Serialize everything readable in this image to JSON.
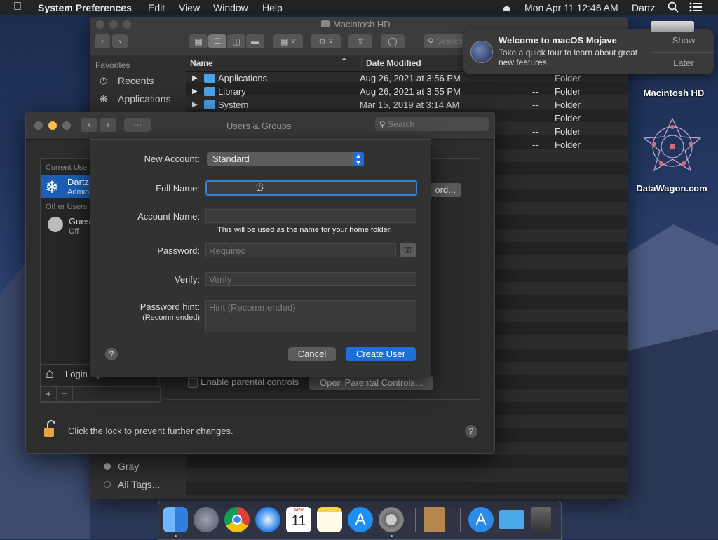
{
  "menubar": {
    "app_name": "System Preferences",
    "menus": [
      "Edit",
      "View",
      "Window",
      "Help"
    ],
    "clock": "Mon Apr 11  12:46 AM",
    "user": "Dartz"
  },
  "finder": {
    "title": "Macintosh HD",
    "search_placeholder": "Search",
    "sidebar_heading": "Favorites",
    "sidebar_items": [
      "Recents",
      "Applications"
    ],
    "tags": [
      "Gray",
      "All Tags..."
    ],
    "columns": {
      "name": "Name",
      "date": "Date Modified"
    },
    "rows": [
      {
        "name": "Applications",
        "date": "Aug 26, 2021 at 3:56 PM",
        "size": "--",
        "kind": "Folder"
      },
      {
        "name": "Library",
        "date": "Aug 26, 2021 at 3:55 PM",
        "size": "--",
        "kind": "Folder"
      },
      {
        "name": "System",
        "date": "Mar 15, 2019 at 3:14 AM",
        "size": "--",
        "kind": "Folder"
      },
      {
        "name": "",
        "date": "",
        "size": "--",
        "kind": "Folder"
      },
      {
        "name": "",
        "date": "",
        "size": "--",
        "kind": "Folder"
      },
      {
        "name": "",
        "date": "",
        "size": "--",
        "kind": "Folder"
      }
    ]
  },
  "notification": {
    "title": "Welcome to macOS Mojave",
    "body_line1": "Take a quick tour to learn about great",
    "body_line2": "new features.",
    "show_label": "Show",
    "later_label": "Later"
  },
  "desktop": {
    "hd_label": "Macintosh HD",
    "datawagon_label": "DataWagon.com"
  },
  "users_groups": {
    "title": "Users & Groups",
    "search_placeholder": "Search",
    "current_users_heading": "Current Use",
    "current_user_name": "Dartz",
    "current_user_role": "Admin",
    "other_users_heading": "Other Users",
    "guest_name": "Gues",
    "guest_status": "Off",
    "login_options": "Login Options",
    "password_button_partial": "ord...",
    "parental_checkbox": "Enable parental controls",
    "parental_button": "Open Parental Controls...",
    "lock_text": "Click the lock to prevent further changes.",
    "help": "?",
    "add": "+",
    "remove": "−"
  },
  "sheet": {
    "new_account_label": "New Account:",
    "new_account_value": "Standard",
    "full_name_label": "Full Name:",
    "full_name_value": "",
    "account_name_label": "Account Name:",
    "account_name_hint": "This will be used as the name for your home folder.",
    "password_label": "Password:",
    "password_placeholder": "Required",
    "verify_label": "Verify:",
    "verify_placeholder": "Verify",
    "hint_label": "Password hint:",
    "hint_sub": "(Recommended)",
    "hint_placeholder": "Hint (Recommended)",
    "help": "?",
    "cancel_label": "Cancel",
    "create_label": "Create User"
  },
  "calendar_badge": {
    "month": "APR",
    "day": "11"
  },
  "colors": {
    "accent": "#1e6fd9",
    "selection": "#1a5fb4"
  }
}
